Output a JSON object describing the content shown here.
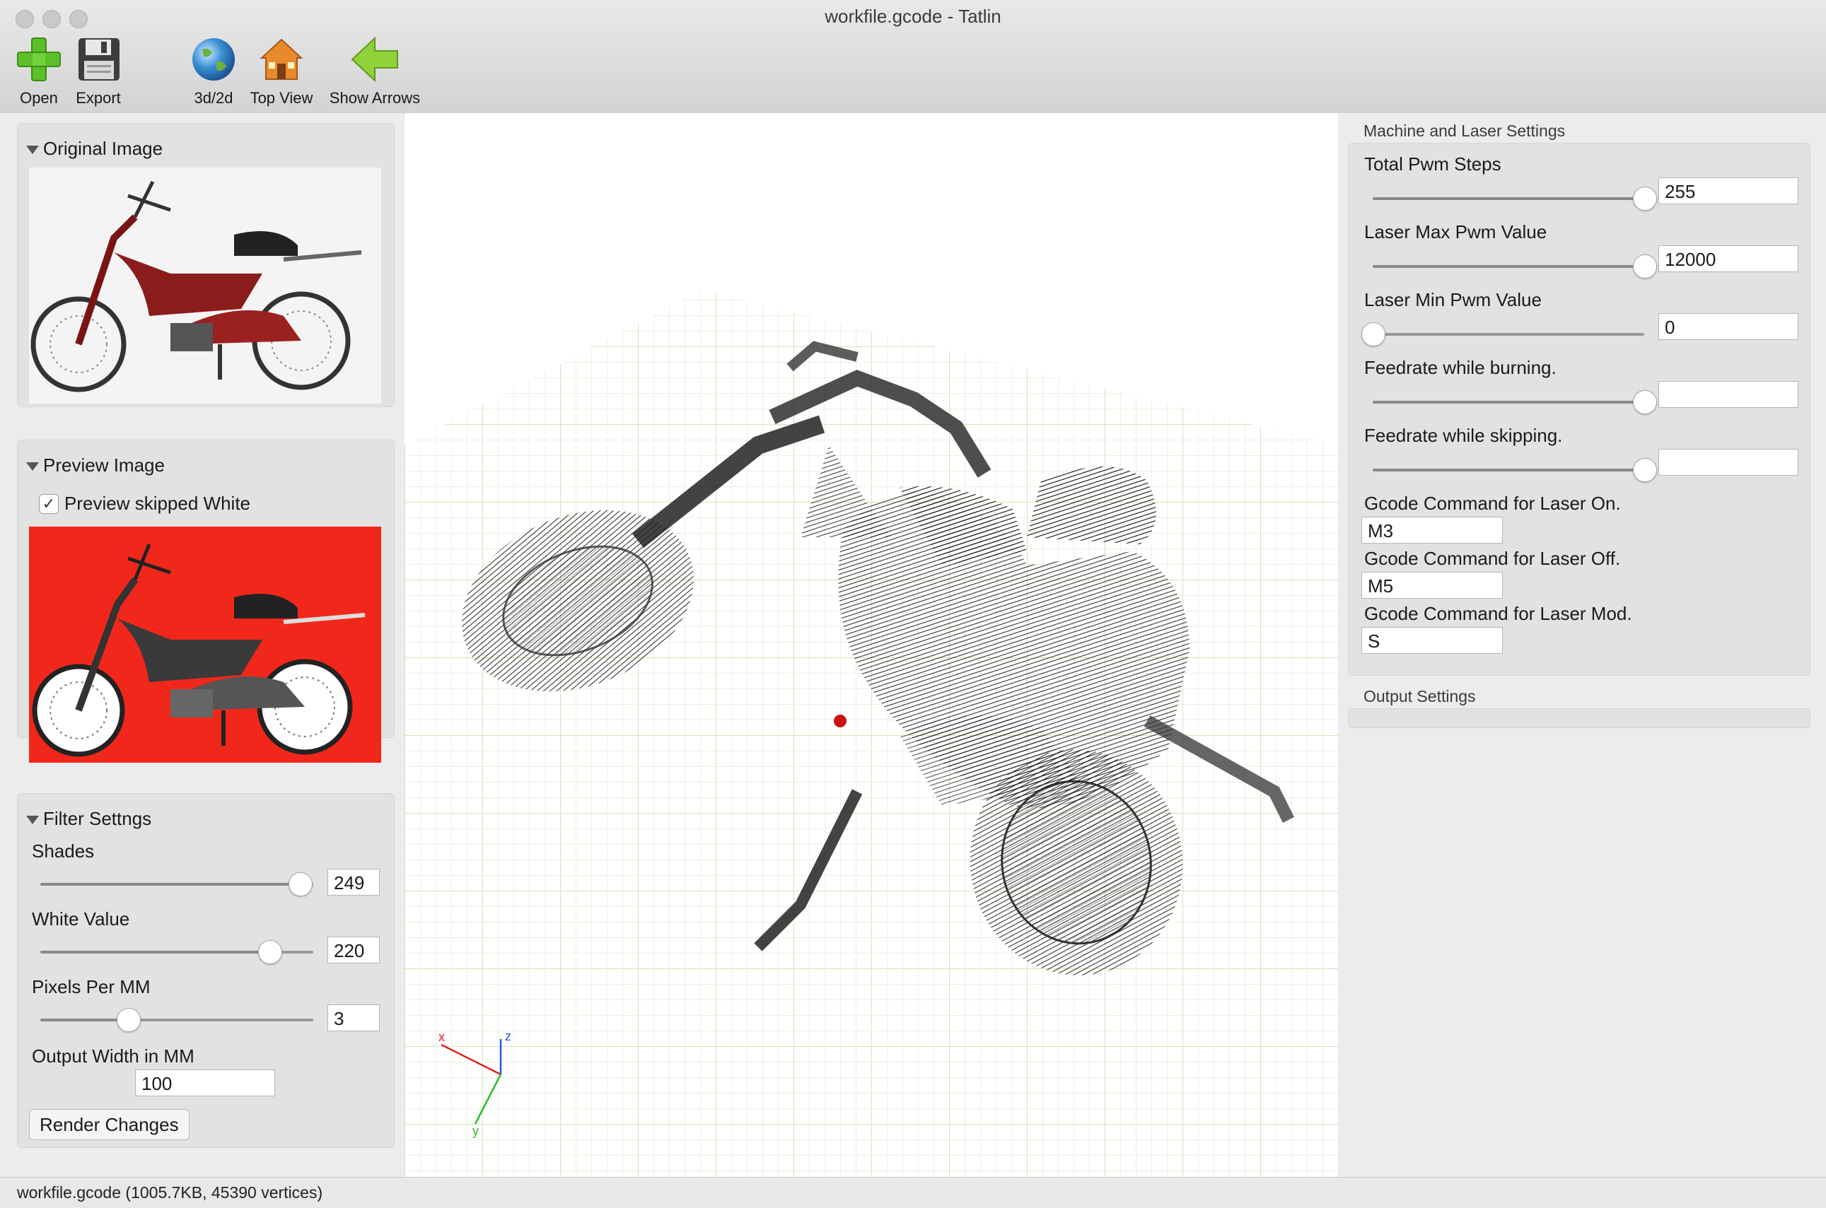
{
  "window": {
    "title": "workfile.gcode - Tatlin"
  },
  "toolbar": {
    "open_label": "Open",
    "export_label": "Export",
    "view3d_label": "3d/2d",
    "topview_label": "Top View",
    "arrows_label": "Show Arrows"
  },
  "left": {
    "original_title": "Original Image",
    "preview_title": "Preview Image",
    "preview_checkbox_label": "Preview skipped White",
    "preview_checked": true,
    "filter_title": "Filter Settngs",
    "shades_label": "Shades",
    "shades_value": "249",
    "shades_level": 0.95,
    "white_label": "White Value",
    "white_value": "220",
    "white_level": 0.84,
    "ppmm_label": "Pixels Per MM",
    "ppmm_value": "3",
    "ppmm_level": 0.32,
    "width_label": "Output Width in MM",
    "width_value": "100",
    "render_label": "Render Changes"
  },
  "viewport": {
    "axes": {
      "x_label": "x",
      "y_label": "y",
      "z_label": "z"
    },
    "grid_color": "#dbe9c7",
    "origin_marker_color": "#cc1111"
  },
  "right": {
    "machine_title": "Machine and Laser Settings",
    "total_pwm_label": "Total Pwm Steps",
    "total_pwm_value": "255",
    "total_pwm_level": 1.0,
    "max_pwm_label": "Laser Max Pwm Value",
    "max_pwm_value": "12000",
    "max_pwm_level": 1.0,
    "min_pwm_label": "Laser Min Pwm Value",
    "min_pwm_value": "0",
    "min_pwm_level": 0.0,
    "feed_burn_label": "Feedrate while burning.",
    "feed_burn_value": "",
    "feed_burn_level": 1.0,
    "feed_skip_label": "Feedrate while skipping.",
    "feed_skip_value": "",
    "feed_skip_level": 1.0,
    "laser_on_label": "Gcode Command for Laser On.",
    "laser_on_value": "M3",
    "laser_off_label": "Gcode Command for Laser Off.",
    "laser_off_value": "M5",
    "laser_mod_label": "Gcode Command for Laser Mod.",
    "laser_mod_value": "S",
    "output_title": "Output Settings"
  },
  "status": {
    "text": "workfile.gcode (1005.7KB, 45390 vertices)"
  },
  "colors": {
    "preview_bg": "#f2271b",
    "moped_red": "#8a1c1c",
    "toolbar_green": "#5cbf2a"
  }
}
